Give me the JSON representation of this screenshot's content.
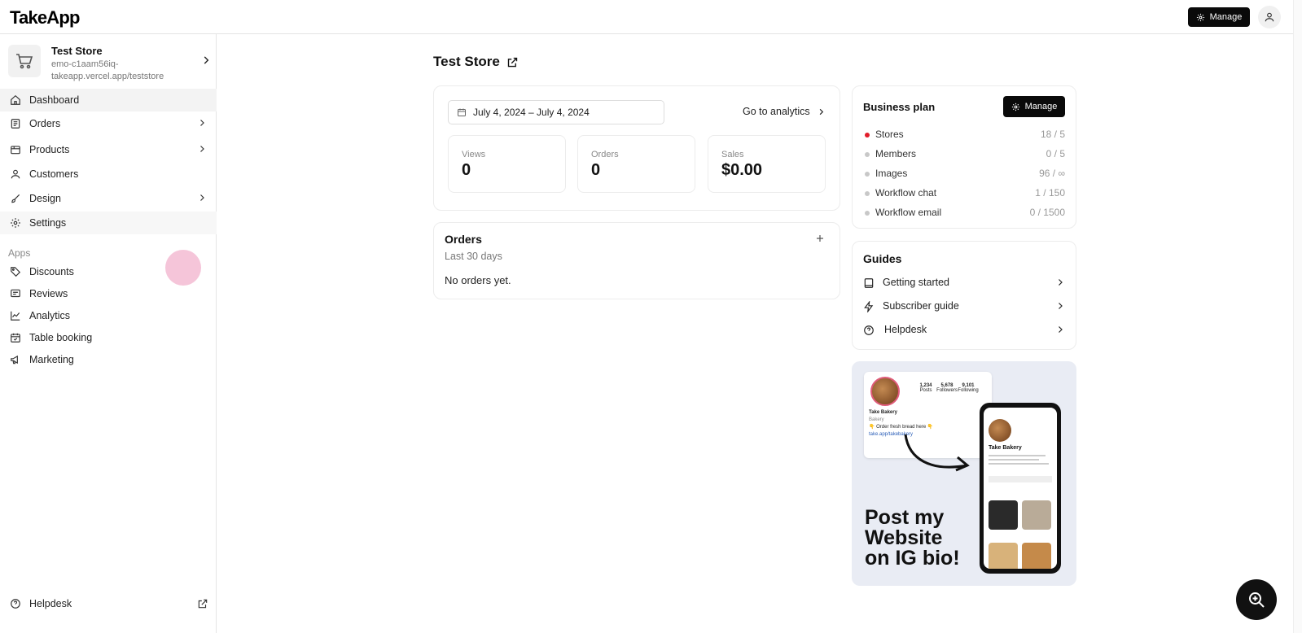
{
  "app": {
    "logo": "TakeApp"
  },
  "header": {
    "manage_label": "Manage"
  },
  "store": {
    "name": "Test Store",
    "url": "emo-c1aam56iq-takeapp.vercel.app/teststore"
  },
  "nav": {
    "dashboard": "Dashboard",
    "orders": "Orders",
    "products": "Products",
    "customers": "Customers",
    "design": "Design",
    "settings": "Settings",
    "apps_label": "Apps",
    "discounts": "Discounts",
    "reviews": "Reviews",
    "analytics": "Analytics",
    "table_booking": "Table booking",
    "marketing": "Marketing",
    "helpdesk": "Helpdesk"
  },
  "main": {
    "title": "Test Store",
    "date_range": "July 4, 2024 – July 4, 2024",
    "go_analytics": "Go to analytics",
    "stats": [
      {
        "label": "Views",
        "value": "0"
      },
      {
        "label": "Orders",
        "value": "0"
      },
      {
        "label": "Sales",
        "value": "$0.00"
      }
    ],
    "orders_card": {
      "title": "Orders",
      "subtitle": "Last 30 days",
      "empty": "No orders yet."
    }
  },
  "plan": {
    "title": "Business plan",
    "manage_label": "Manage",
    "rows": [
      {
        "name": "Stores",
        "count": "18 / 5"
      },
      {
        "name": "Members",
        "count": "0 / 5"
      },
      {
        "name": "Images",
        "count": "96 / ∞"
      },
      {
        "name": "Workflow chat",
        "count": "1 / 150"
      },
      {
        "name": "Workflow email",
        "count": "0 / 1500"
      }
    ]
  },
  "guides": {
    "title": "Guides",
    "items": [
      "Getting started",
      "Subscriber guide",
      "Helpdesk"
    ]
  },
  "promo": {
    "line1": "Post my",
    "line2": "Website",
    "line3": "on IG bio!",
    "ig_stats": [
      {
        "num": "1,234",
        "label": "Posts"
      },
      {
        "num": "5,678",
        "label": "Followers"
      },
      {
        "num": "9,101",
        "label": "Following"
      }
    ],
    "ig_name": "Take Bakery",
    "ig_category": "Bakery",
    "ig_bio": "👇 Order fresh bread here 👇",
    "ig_link": "take.app/takebakery",
    "phone_name": "Take Bakery"
  },
  "colors": {
    "accent": "#0a0a0a",
    "alert": "#e11d2a"
  }
}
